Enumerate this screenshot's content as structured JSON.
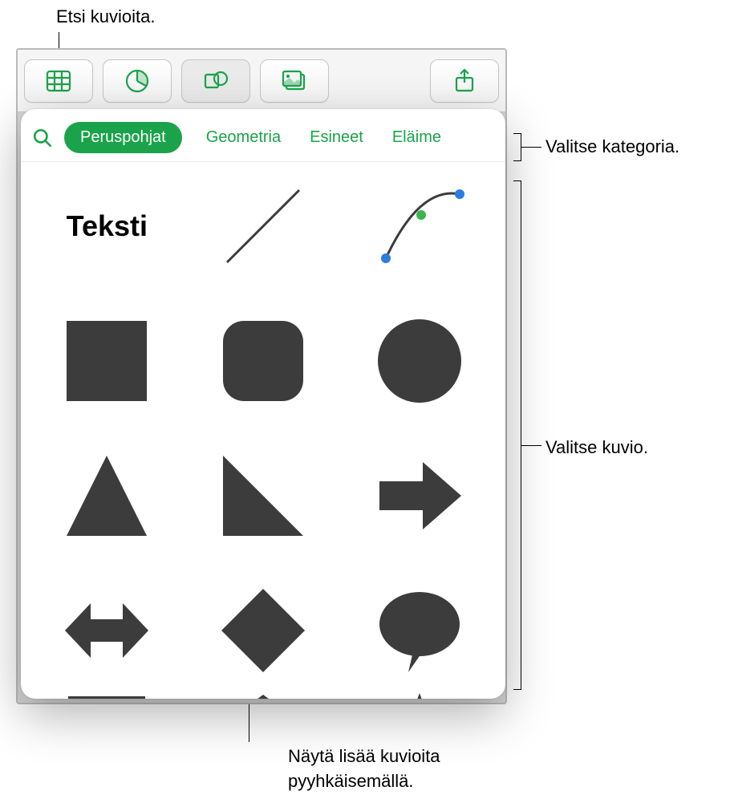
{
  "callouts": {
    "search": "Etsi kuvioita.",
    "category": "Valitse kategoria.",
    "shape": "Valitse kuvio.",
    "swipe_line1": "Näytä lisää kuvioita",
    "swipe_line2": "pyyhkäisemällä."
  },
  "toolbar": {
    "icons": [
      "table-icon",
      "chart-icon",
      "shape-icon",
      "media-icon",
      "share-icon"
    ]
  },
  "popover": {
    "tabs": [
      "Peruspohjat",
      "Geometria",
      "Esineet",
      "Eläime"
    ],
    "text_shape_label": "Teksti",
    "shapes": [
      "text",
      "line",
      "curve",
      "square",
      "rounded-square",
      "circle",
      "triangle",
      "right-triangle",
      "arrow-right",
      "arrow-leftright",
      "diamond",
      "speech-bubble",
      "callout-rect",
      "pentagon",
      "star"
    ]
  }
}
